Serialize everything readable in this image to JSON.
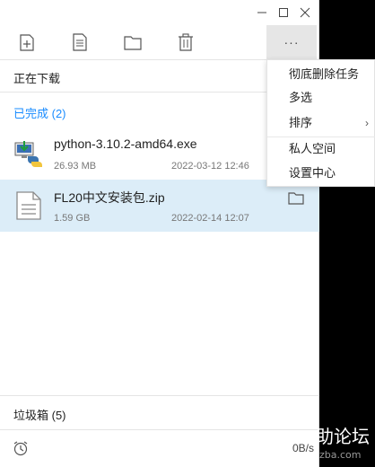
{
  "window": {
    "title_controls": [
      "minimize-icon",
      "maximize-icon",
      "close-icon"
    ]
  },
  "toolbar": {
    "tools": [
      "new-task-icon",
      "document-icon",
      "folder-icon",
      "trash-icon"
    ],
    "more_label": "···"
  },
  "sections": {
    "downloading": "正在下载",
    "completed": "已完成 (2)",
    "trash": "垃圾箱 (5)"
  },
  "items": [
    {
      "name": "python-3.10.2-amd64.exe",
      "size": "26.93 MB",
      "date": "2022-03-12 12:46",
      "icon": "python-installer-icon"
    },
    {
      "name": "FL20中文安装包.zip",
      "size": "1.59 GB",
      "date": "2022-02-14 12:07",
      "icon": "zip-file-icon"
    }
  ],
  "statusbar": {
    "speed": "0B/s"
  },
  "context_menu": {
    "items": [
      {
        "label": "彻底删除任务"
      },
      {
        "label": "多选"
      },
      {
        "label": "排序",
        "arrow": "›"
      },
      {
        "label": "私人空间"
      },
      {
        "label": "设置中心"
      }
    ]
  },
  "watermark": {
    "text": "助论坛",
    "url": "zba.com"
  },
  "colors": {
    "accent": "#1a8cff",
    "selected_bg": "#dcedf8",
    "menu_hover": "#e6e6e6"
  }
}
